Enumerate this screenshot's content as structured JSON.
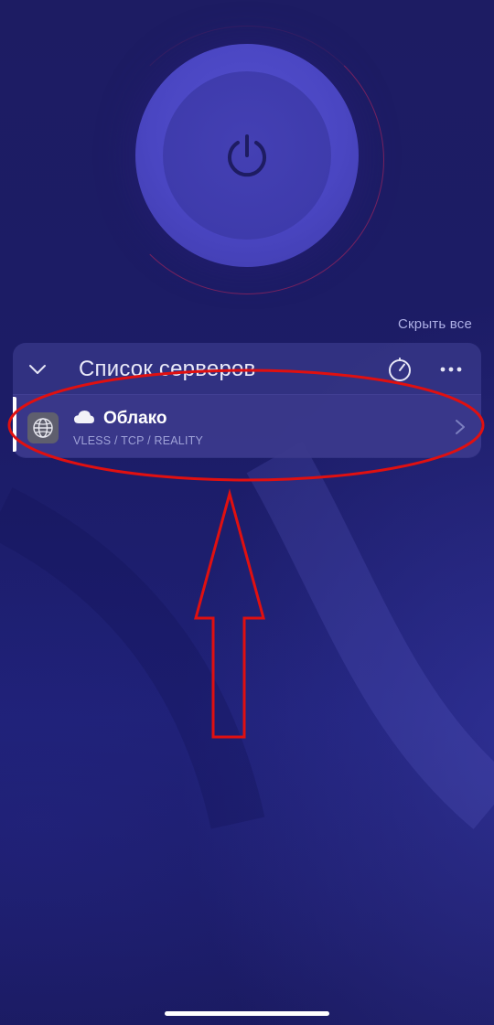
{
  "colors": {
    "background": "#1d1c63",
    "power_button": "#4a46c2",
    "annotation_red": "#e01010"
  },
  "power_button": {
    "icon": "power-icon"
  },
  "hide_all_label": "Скрыть все",
  "server_list": {
    "title": "Список серверов",
    "collapse_icon": "chevron-down-icon",
    "speed_test_icon": "speedometer-icon",
    "more_icon": "more-horizontal-icon",
    "servers": [
      {
        "icon": "globe-icon",
        "emoji_icon": "cloud-icon",
        "name": "Облако",
        "meta": "VLESS / TCP / REALITY",
        "selected": true
      }
    ]
  },
  "annotation": {
    "ellipse": "red-ellipse-highlight",
    "arrow": "red-up-arrow"
  }
}
